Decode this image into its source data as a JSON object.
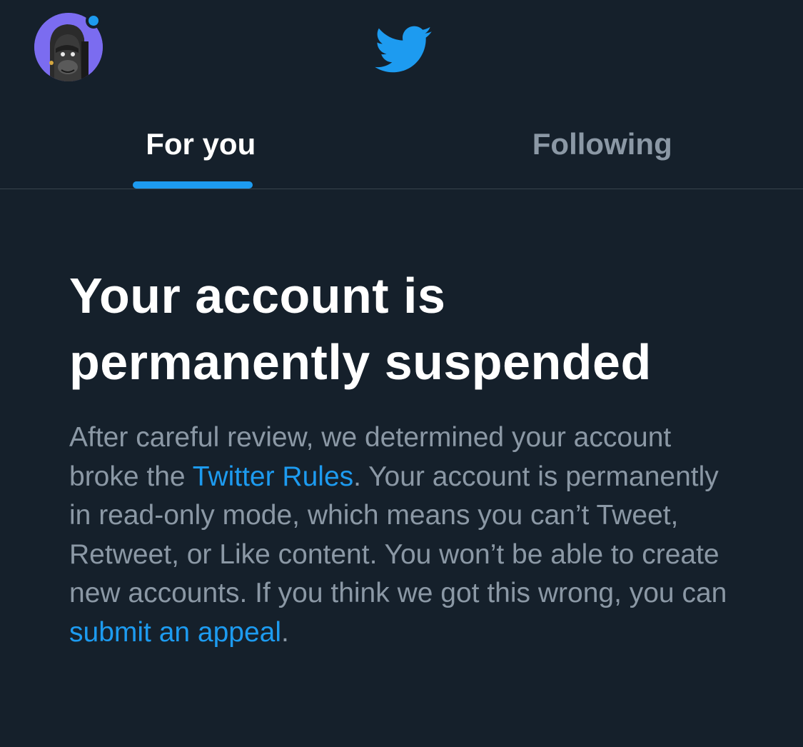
{
  "header": {
    "avatar_icon": "ape-avatar-icon",
    "logo_icon": "twitter-bird-icon",
    "colors": {
      "background": "#15202b",
      "accent": "#1d9bf0",
      "muted_text": "#8b98a5",
      "divider": "#38444d"
    }
  },
  "tabs": [
    {
      "label": "For you",
      "active": true
    },
    {
      "label": "Following",
      "active": false
    }
  ],
  "notice": {
    "title": "Your account is permanently suspended",
    "body_part1": "After careful review, we determined your account broke the ",
    "rules_link": "Twitter Rules",
    "body_part2": ". Your account is permanently in read-only mode, which means you can’t Tweet, Retweet, or Like content. You won’t be able to create new accounts. If you think we got this wrong, you can ",
    "appeal_link": "submit an appeal",
    "body_part3": "."
  }
}
